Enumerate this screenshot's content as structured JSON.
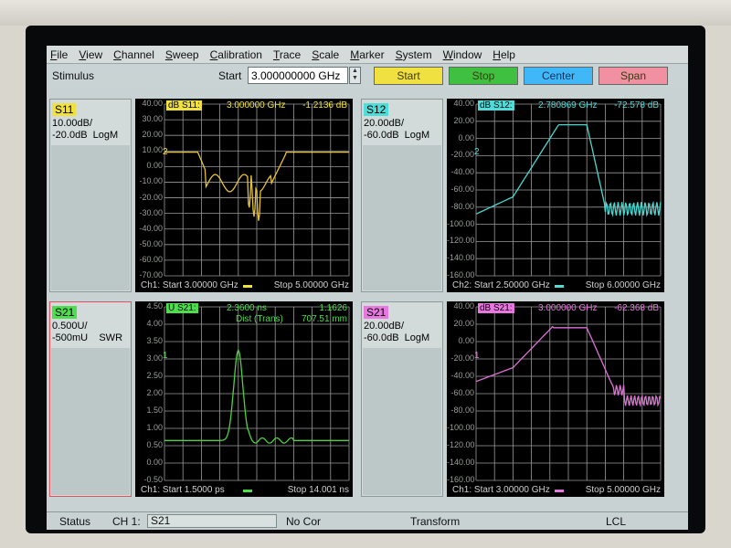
{
  "menu": [
    "File",
    "View",
    "Channel",
    "Sweep",
    "Calibration",
    "Trace",
    "Scale",
    "Marker",
    "System",
    "Window",
    "Help"
  ],
  "toolbar": {
    "stimulus_label": "Stimulus",
    "start_label": "Start",
    "start_value": "3.000000000 GHz",
    "buttons": [
      "Start",
      "Stop",
      "Center",
      "Span"
    ],
    "colors": [
      "#f0e040",
      "#40c040",
      "#40b8f8",
      "#f090a0"
    ]
  },
  "channels": [
    {
      "label": "S11",
      "label_color": "#f0e040",
      "info": "10.00dB/\n-20.0dB  LogM",
      "badge": "dB S11:",
      "marker": "3.000000 GHz",
      "value": "-1.2136 dB",
      "trace_color": "#e6c23a",
      "yticks": [
        "40.00",
        "30.00",
        "20.00",
        "10.00",
        "0.00",
        "-10.00",
        "-20.00",
        "-30.00",
        "-40.00",
        "-50.00",
        "-60.00",
        "-70.00"
      ],
      "foot_start": "Ch1: Start  3.00000 GHz",
      "foot_stop": "Stop  5.00000 GHz",
      "marker_num": "2"
    },
    {
      "label": "S12",
      "label_color": "#50dcd8",
      "info": "20.00dB/\n-60.0dB  LogM",
      "badge": "dB S12:",
      "marker": "2.780869 GHz",
      "value": "-72.578 dB",
      "trace_color": "#48d8d0",
      "yticks": [
        "40.00",
        "20.00",
        "0.00",
        "-20.00",
        "-40.00",
        "-60.00",
        "-80.00",
        "-100.00",
        "-120.00",
        "-140.00",
        "-160.00"
      ],
      "foot_start": "Ch2: Start  2.50000 GHz",
      "foot_stop": "Stop  6.00000 GHz",
      "marker_num": "2"
    },
    {
      "label": "S21",
      "label_color": "#50dc50",
      "info": "0.500U/\n-500mU    SWR",
      "badge": "U S21:",
      "marker": "2.3600 ns",
      "value": "1.1626",
      "dist_label": "Dist (Trans)",
      "dist_value": "707.51 mm",
      "trace_color": "#50d040",
      "yticks": [
        "4.50",
        "4.00",
        "3.50",
        "3.00",
        "2.50",
        "2.00",
        "1.50",
        "1.00",
        "0.50",
        "0.00",
        "-0.50"
      ],
      "foot_start": "Ch1: Start  1.5000 ps",
      "foot_stop": "Stop  14.001 ns",
      "marker_num": "1"
    },
    {
      "label": "S21",
      "label_color": "#e878e0",
      "info": "20.00dB/\n-60.0dB  LogM",
      "badge": "dB S21:",
      "marker": "3.000000 GHz",
      "value": "-62.368 dB",
      "trace_color": "#e070d8",
      "yticks": [
        "40.00",
        "20.00",
        "0.00",
        "-20.00",
        "-40.00",
        "-60.00",
        "-80.00",
        "-100.00",
        "-120.00",
        "-140.00",
        "-160.00"
      ],
      "foot_start": "Ch1: Start  3.00000 GHz",
      "foot_stop": "Stop  5.00000 GHz",
      "marker_num": "1"
    }
  ],
  "status": {
    "status_label": "Status",
    "channel": "CH 1:",
    "param": "S21",
    "correction": "No Cor",
    "transform": "Transform",
    "mode": "LCL"
  }
}
